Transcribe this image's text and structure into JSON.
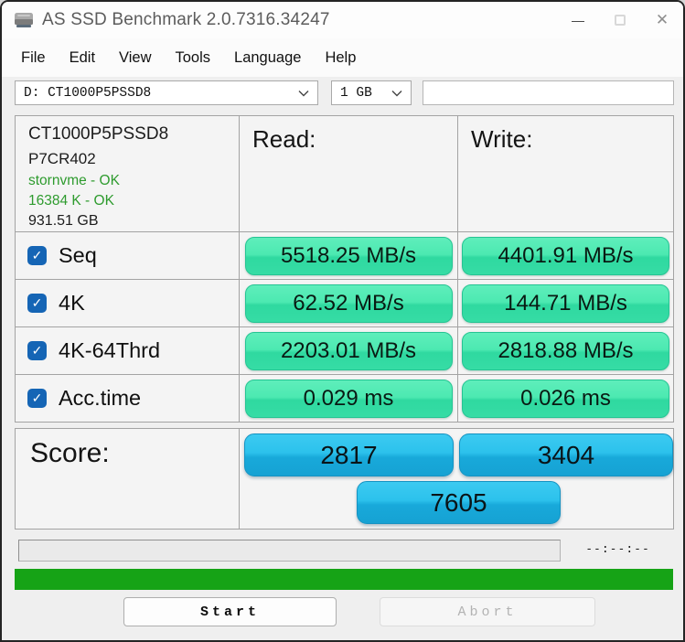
{
  "window": {
    "title": "AS SSD Benchmark 2.0.7316.34247"
  },
  "icons": {
    "minimize_glyph": "—",
    "close_glyph": "✕",
    "check_glyph": "✓"
  },
  "menu": {
    "items": [
      {
        "label": "File"
      },
      {
        "label": "Edit"
      },
      {
        "label": "View"
      },
      {
        "label": "Tools"
      },
      {
        "label": "Language"
      },
      {
        "label": "Help"
      }
    ]
  },
  "toolbar": {
    "drive_select_value": "D: CT1000P5PSSD8",
    "size_select_value": "1 GB"
  },
  "drive_info": {
    "model": "CT1000P5PSSD8",
    "firmware": "P7CR402",
    "driver_status": "stornvme - OK",
    "alignment_status": "16384 K - OK",
    "capacity": "931.51 GB"
  },
  "results": {
    "read_header": "Read:",
    "write_header": "Write:",
    "rows": [
      {
        "label": "Seq",
        "checked": true,
        "read": "5518.25 MB/s",
        "write": "4401.91 MB/s"
      },
      {
        "label": "4K",
        "checked": true,
        "read": "62.52 MB/s",
        "write": "144.71 MB/s"
      },
      {
        "label": "4K-64Thrd",
        "checked": true,
        "read": "2203.01 MB/s",
        "write": "2818.88 MB/s"
      },
      {
        "label": "Acc.time",
        "checked": true,
        "read": "0.029 ms",
        "write": "0.026 ms"
      }
    ]
  },
  "score": {
    "label": "Score:",
    "read_score": "2817",
    "write_score": "3404",
    "total_score": "7605"
  },
  "progress": {
    "timer": "--:--:--"
  },
  "actions": {
    "start": "Start",
    "abort": "Abort"
  },
  "colors": {
    "result_pill_top": "#5FEEBB",
    "result_pill_bottom": "#2FD9A0",
    "score_pill_top": "#3CCAF1",
    "score_pill_bottom": "#16A2D3",
    "status_text_green": "#2E9B2E",
    "progress_bar_green": "#16A316",
    "checkbox_blue": "#1565B5"
  }
}
